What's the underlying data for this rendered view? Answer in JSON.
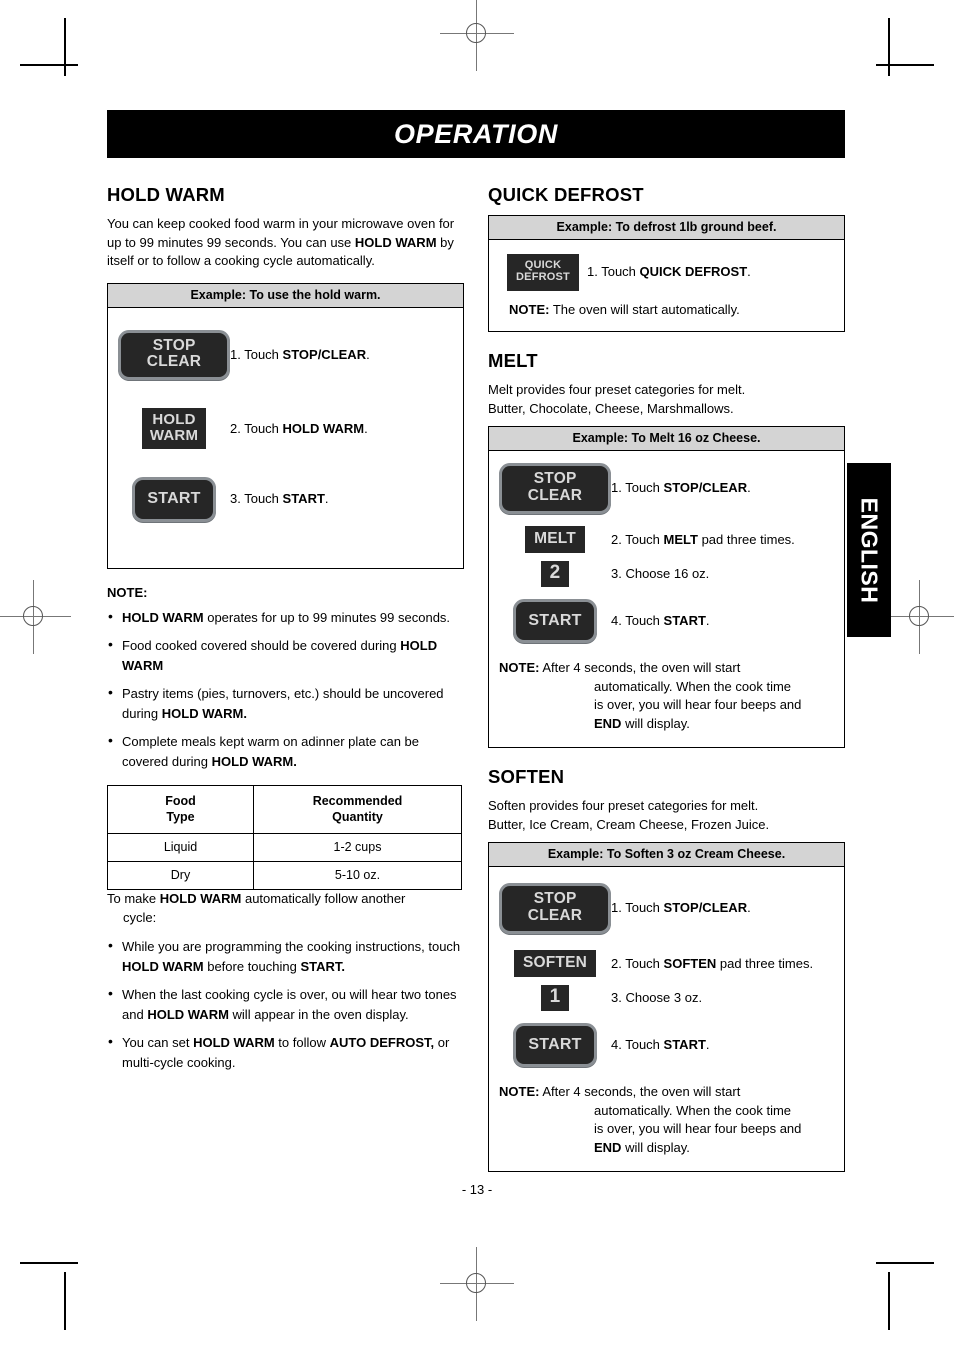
{
  "banner": {
    "title": "OPERATION"
  },
  "page_number": "- 13 -",
  "side_tab": {
    "label": "ENGLISH"
  },
  "left_column": {
    "hold_warm": {
      "heading": "HOLD WARM",
      "intro_1": "You can keep cooked food warm in your microwave",
      "intro_2": "oven for up to 99 minutes 99 seconds. You can use",
      "intro_3_bold": "HOLD WARM",
      "intro_3_rest": " by itself or to follow a cooking cycle",
      "intro_4": "automatically.",
      "example": {
        "header": "Example: To use the hold warm.",
        "steps": [
          {
            "pad_type": "stop-clear",
            "pad_line1": "STOP",
            "pad_line2": "CLEAR",
            "num": "1. Touch ",
            "bold": "STOP/CLEAR",
            "tail": "."
          },
          {
            "pad_type": "hold-warm",
            "pad_line1": "HOLD",
            "pad_line2": "WARM",
            "num": "2. Touch ",
            "bold": "HOLD WARM",
            "tail": "."
          },
          {
            "pad_type": "start",
            "pad_line1": "START",
            "num": "3. Touch ",
            "bold": "START",
            "tail": "."
          }
        ]
      },
      "note_title": "NOTE:",
      "notes": [
        {
          "bold_lead": "HOLD WARM",
          "text": " operates  for  up  to  99  minutes  99 seconds."
        },
        {
          "bold_lead": "",
          "text": "Food cooked covered should be covered during ",
          "bold_tail": "HOLD WARM"
        },
        {
          "bold_lead": "",
          "text": "Pastry items (pies, turnovers, etc.) should be uncovered during  ",
          "bold_tail": "HOLD WARM."
        },
        {
          "bold_lead": "",
          "text": "Complete meals kept warm on adinner plate can be covered during  ",
          "bold_tail": "HOLD WARM."
        }
      ],
      "table": {
        "headers": [
          "Food\nType",
          "Recommended\nQuantity"
        ],
        "header_left_l1": "Food",
        "header_left_l2": "Type",
        "header_right_l1": "Recommended",
        "header_right_l2": "Quantity",
        "rows": [
          {
            "type": "Liquid",
            "quantity": "1-2 cups"
          },
          {
            "type": "Dry",
            "quantity": "5-10 oz."
          }
        ]
      },
      "followup_intro_a": "To make  ",
      "followup_intro_bold": "HOLD WARM",
      "followup_intro_b": " automatically follow another",
      "followup_intro_c": "cycle:",
      "followup_notes": [
        {
          "a": "While you are programming the cooking instructions, touch  ",
          "b": "HOLD WARM",
          "c": " before touching  ",
          "d": "START."
        },
        {
          "a": "When the last cooking cycle is over, ou will hear two tones and  ",
          "b": "HOLD WARM",
          "c": " will appear in the oven display.",
          "d": ""
        },
        {
          "a": "You can set ",
          "b": "HOLD WARM",
          "c": " to follow ",
          "d": "AUTO DEFROST,",
          "e": " or multi-cycle cooking."
        }
      ]
    }
  },
  "right_column": {
    "quick_defrost": {
      "heading": "QUICK DEFROST",
      "example": {
        "header": "Example: To defrost 1lb ground beef.",
        "pad_line1": "QUICK",
        "pad_line2": "DEFROST",
        "step_num": "1. Touch ",
        "step_bold": "QUICK DEFROST",
        "step_tail": ".",
        "note_bold": "NOTE:",
        "note_text": " The oven will start automatically."
      }
    },
    "melt": {
      "heading": "MELT",
      "intro_1": "Melt provides four preset categories for melt.",
      "intro_2": "Butter, Chocolate, Cheese, Marshmallows.",
      "example": {
        "header": "Example: To Melt 16 oz Cheese.",
        "steps": [
          {
            "pad_type": "stop-clear",
            "pad_line1": "STOP",
            "pad_line2": "CLEAR",
            "num": "1. Touch ",
            "bold": "STOP/CLEAR",
            "tail": "."
          },
          {
            "pad_type": "word",
            "pad_line1": "MELT",
            "num": "2. Touch ",
            "bold": "MELT",
            "tail": " pad three times."
          },
          {
            "pad_type": "num",
            "pad_line1": "2",
            "num": "3. Choose 16 oz.",
            "bold": "",
            "tail": ""
          },
          {
            "pad_type": "start",
            "pad_line1": "START",
            "num": "4. Touch ",
            "bold": "START",
            "tail": "."
          }
        ],
        "note_bold": "NOTE:",
        "note_l1": " After 4 seconds, the oven will start",
        "note_l2": "automatically. When the cook time",
        "note_l3": "is over, you will hear four beeps and",
        "note_l4_bold": "END",
        "note_l4_rest": " will display."
      }
    },
    "soften": {
      "heading": "SOFTEN",
      "intro_1": "Soften provides four preset categories for melt.",
      "intro_2": "Butter, Ice Cream, Cream Cheese, Frozen Juice.",
      "example": {
        "header": "Example: To Soften 3 oz Cream Cheese.",
        "steps": [
          {
            "pad_type": "stop-clear",
            "pad_line1": "STOP",
            "pad_line2": "CLEAR",
            "num": "1. Touch ",
            "bold": "STOP/CLEAR",
            "tail": "."
          },
          {
            "pad_type": "word",
            "pad_line1": "SOFTEN",
            "num": "2. Touch ",
            "bold": "SOFTEN",
            "tail": " pad three times."
          },
          {
            "pad_type": "num",
            "pad_line1": "1",
            "num": "3. Choose 3 oz.",
            "bold": "",
            "tail": ""
          },
          {
            "pad_type": "start",
            "pad_line1": "START",
            "num": "4. Touch ",
            "bold": "START",
            "tail": "."
          }
        ],
        "note_bold": "NOTE:",
        "note_l1": " After 4 seconds, the oven will start",
        "note_l2": "automatically. When the cook time",
        "note_l3": "is over, you will hear four beeps and",
        "note_l4_bold": "END",
        "note_l4_rest": " will display."
      }
    }
  },
  "colors": {
    "banner_bg": "#000000",
    "example_header_bg": "#d4d4d4",
    "pad_bg": "#262626",
    "pad_text": "#d9d9d9",
    "pad_border": "#8a8f94",
    "stop_clear_rule": "#e02020"
  }
}
